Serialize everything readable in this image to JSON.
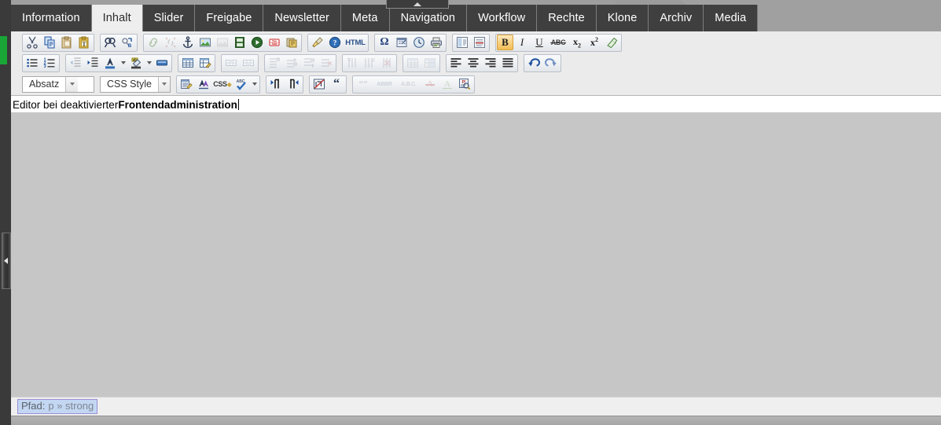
{
  "window": {
    "background_color": "#9b9b9b",
    "editor_chrome_color": "#ebebeb",
    "accent_green": "#1aa637"
  },
  "rail": {
    "collapse_handle_name": "collapse-panel-handle",
    "green_marker_color": "#1aa637"
  },
  "top_pulltab": {
    "name": "expand-toolbar-tab"
  },
  "tabs": [
    {
      "id": "information",
      "label": "Information",
      "active": false
    },
    {
      "id": "inhalt",
      "label": "Inhalt",
      "active": true
    },
    {
      "id": "slider",
      "label": "Slider",
      "active": false
    },
    {
      "id": "freigabe",
      "label": "Freigabe",
      "active": false
    },
    {
      "id": "newsletter",
      "label": "Newsletter",
      "active": false
    },
    {
      "id": "meta",
      "label": "Meta",
      "active": false
    },
    {
      "id": "navigation",
      "label": "Navigation",
      "active": false
    },
    {
      "id": "workflow",
      "label": "Workflow",
      "active": false
    },
    {
      "id": "rechte",
      "label": "Rechte",
      "active": false
    },
    {
      "id": "klone",
      "label": "Klone",
      "active": false
    },
    {
      "id": "archiv",
      "label": "Archiv",
      "active": false
    },
    {
      "id": "media",
      "label": "Media",
      "active": false
    }
  ],
  "toolbar": {
    "row1": [
      {
        "group": "clipboard",
        "buttons": [
          {
            "icon": "cut-icon",
            "title": "Ausschneiden",
            "state": "enabled"
          },
          {
            "icon": "copy-icon",
            "title": "Kopieren",
            "state": "enabled"
          },
          {
            "icon": "paste-icon",
            "title": "Einfügen",
            "state": "enabled"
          },
          {
            "icon": "paste-as-text-icon",
            "title": "Als Text einfügen",
            "state": "enabled"
          }
        ]
      },
      {
        "group": "search",
        "buttons": [
          {
            "icon": "find-icon",
            "title": "Suchen",
            "state": "enabled"
          },
          {
            "icon": "find-replace-icon",
            "title": "Suchen/Ersetzen",
            "state": "enabled"
          }
        ]
      },
      {
        "group": "insert",
        "buttons": [
          {
            "icon": "link-icon",
            "title": "Link einfügen",
            "state": "disabled"
          },
          {
            "icon": "unlink-icon",
            "title": "Link entfernen",
            "state": "disabled"
          },
          {
            "icon": "anchor-icon",
            "title": "Anker",
            "state": "enabled"
          },
          {
            "icon": "image-icon",
            "title": "Bild einfügen",
            "state": "enabled"
          },
          {
            "icon": "image-alt-icon",
            "title": "Bild",
            "state": "disabled"
          },
          {
            "icon": "filmstrip-icon",
            "title": "Medien",
            "state": "enabled"
          },
          {
            "icon": "play-media-icon",
            "title": "Media abspielen",
            "state": "enabled"
          },
          {
            "icon": "youtube-icon",
            "title": "YouTube",
            "state": "enabled"
          },
          {
            "icon": "flash-icon",
            "title": "Flash",
            "state": "enabled"
          }
        ]
      },
      {
        "group": "cleanup",
        "buttons": [
          {
            "icon": "broom-cleanup-icon",
            "title": "Aufräumen",
            "state": "enabled"
          },
          {
            "icon": "help-icon",
            "title": "Hilfe",
            "state": "enabled"
          },
          {
            "icon": "html-source-icon",
            "title": "HTML",
            "state": "enabled",
            "text": "HTML"
          }
        ]
      },
      {
        "group": "special",
        "buttons": [
          {
            "icon": "omega-special-char-icon",
            "title": "Sonderzeichen",
            "state": "enabled",
            "text": "Ω"
          },
          {
            "icon": "insert-date-icon",
            "title": "Datum",
            "state": "enabled"
          },
          {
            "icon": "insert-time-icon",
            "title": "Uhrzeit",
            "state": "enabled"
          },
          {
            "icon": "print-icon",
            "title": "Drucken",
            "state": "enabled"
          }
        ]
      },
      {
        "group": "breaks",
        "buttons": [
          {
            "icon": "page-break-icon",
            "title": "Seitenumbruch",
            "state": "enabled"
          },
          {
            "icon": "horizontal-rule-icon",
            "title": "Trennlinie",
            "state": "enabled"
          }
        ]
      },
      {
        "group": "formatting",
        "buttons": [
          {
            "icon": "bold-icon",
            "title": "Fett",
            "state": "active",
            "text": "B"
          },
          {
            "icon": "italic-icon",
            "title": "Kursiv",
            "state": "enabled",
            "text": "I"
          },
          {
            "icon": "underline-icon",
            "title": "Unterstrichen",
            "state": "enabled",
            "text": "U"
          },
          {
            "icon": "strikethrough-icon",
            "title": "Durchgestrichen",
            "state": "enabled",
            "text": "ABC"
          },
          {
            "icon": "subscript-icon",
            "title": "Tiefgestellt",
            "state": "enabled",
            "text": "x₂"
          },
          {
            "icon": "superscript-icon",
            "title": "Hochgestellt",
            "state": "enabled",
            "text": "x²"
          },
          {
            "icon": "remove-format-icon",
            "title": "Format entfernen",
            "state": "enabled"
          }
        ]
      }
    ],
    "row2": [
      {
        "group": "lists",
        "buttons": [
          {
            "icon": "bullet-list-icon",
            "title": "Aufzählung",
            "state": "enabled"
          },
          {
            "icon": "numbered-list-icon",
            "title": "Nummerierte Liste",
            "state": "enabled"
          }
        ]
      },
      {
        "group": "indent-color",
        "buttons": [
          {
            "icon": "outdent-icon",
            "title": "Ausrücken",
            "state": "disabled"
          },
          {
            "icon": "indent-icon",
            "title": "Einrücken",
            "state": "enabled"
          },
          {
            "icon": "text-color-icon",
            "title": "Textfarbe",
            "state": "enabled",
            "has_caret": true
          },
          {
            "icon": "highlight-color-icon",
            "title": "Hintergrundfarbe",
            "state": "enabled",
            "has_caret": true
          },
          {
            "icon": "color-swatch-icon",
            "title": "Farbe",
            "state": "enabled"
          }
        ]
      },
      {
        "group": "table-main",
        "buttons": [
          {
            "icon": "insert-table-icon",
            "title": "Tabelle einfügen",
            "state": "enabled"
          },
          {
            "icon": "table-properties-icon",
            "title": "Tabelleneigenschaften",
            "state": "enabled"
          }
        ]
      },
      {
        "group": "table-cells",
        "buttons": [
          {
            "icon": "merge-cells-icon",
            "title": "Zellen verbinden",
            "state": "disabled"
          },
          {
            "icon": "split-cells-icon",
            "title": "Zellen teilen",
            "state": "disabled"
          }
        ]
      },
      {
        "group": "table-rows",
        "buttons": [
          {
            "icon": "row-properties-icon",
            "title": "Zeileneigenschaften",
            "state": "disabled"
          },
          {
            "icon": "insert-row-before-icon",
            "title": "Zeile davor",
            "state": "disabled"
          },
          {
            "icon": "insert-row-after-icon",
            "title": "Zeile danach",
            "state": "disabled"
          },
          {
            "icon": "delete-row-icon",
            "title": "Zeile löschen",
            "state": "disabled"
          }
        ]
      },
      {
        "group": "table-cols",
        "buttons": [
          {
            "icon": "insert-col-before-icon",
            "title": "Spalte davor",
            "state": "disabled"
          },
          {
            "icon": "insert-col-after-icon",
            "title": "Spalte danach",
            "state": "disabled"
          },
          {
            "icon": "delete-col-icon",
            "title": "Spalte löschen",
            "state": "disabled"
          }
        ]
      },
      {
        "group": "table-extra",
        "buttons": [
          {
            "icon": "table-grid-icon",
            "title": "Tabellenraster",
            "state": "disabled"
          },
          {
            "icon": "table-overlay-icon",
            "title": "Tabellenoverlay",
            "state": "disabled"
          }
        ]
      },
      {
        "group": "align",
        "buttons": [
          {
            "icon": "align-left-icon",
            "title": "Linksbündig",
            "state": "enabled"
          },
          {
            "icon": "align-center-icon",
            "title": "Zentriert",
            "state": "enabled"
          },
          {
            "icon": "align-right-icon",
            "title": "Rechtsbündig",
            "state": "enabled"
          },
          {
            "icon": "align-justify-icon",
            "title": "Blocksatz",
            "state": "enabled"
          }
        ]
      },
      {
        "group": "history",
        "buttons": [
          {
            "icon": "undo-icon",
            "title": "Rückgängig",
            "state": "enabled"
          },
          {
            "icon": "redo-icon",
            "title": "Wiederholen",
            "state": "enabled"
          }
        ]
      }
    ],
    "row3": {
      "format_select": {
        "value": "Absatz",
        "name": "format-select"
      },
      "cssstyle_select": {
        "value": "CSS Style",
        "name": "css-style-select"
      },
      "buttons_a": [
        {
          "icon": "edit-attributes-icon",
          "title": "Attribute bearbeiten",
          "state": "enabled"
        },
        {
          "icon": "advanced-font-icon",
          "title": "Schrift",
          "state": "enabled"
        },
        {
          "icon": "css-edit-icon",
          "title": "CSS",
          "state": "enabled",
          "text": "CSS"
        },
        {
          "icon": "spellcheck-icon",
          "title": "Rechtschreibprüfung",
          "state": "enabled",
          "has_caret": true
        }
      ],
      "buttons_b": [
        {
          "icon": "ltr-direction-icon",
          "title": "Textrichtung links-rechts",
          "state": "enabled"
        },
        {
          "icon": "rtl-direction-icon",
          "title": "Textrichtung rechts-links",
          "state": "enabled"
        }
      ],
      "buttons_c": [
        {
          "icon": "nonbreaking-icon",
          "title": "Geschütztes Leerzeichen",
          "state": "enabled"
        },
        {
          "icon": "blockquote-icon",
          "title": "Zitat",
          "state": "enabled",
          "text": "“"
        }
      ],
      "buttons_d": [
        {
          "icon": "citation-icon",
          "title": "Zitat",
          "state": "disabled",
          "text": "“ ”"
        },
        {
          "icon": "abbreviation-icon",
          "title": "Abkürzung",
          "state": "disabled",
          "text": "ABBR"
        },
        {
          "icon": "acronym-icon",
          "title": "Akronym",
          "state": "disabled",
          "text": "A.B.C."
        },
        {
          "icon": "delete-mark-icon",
          "title": "Gelöscht",
          "state": "disabled",
          "text": "A"
        },
        {
          "icon": "insert-mark-icon",
          "title": "Eingefügt",
          "state": "disabled",
          "text": "A"
        },
        {
          "icon": "preview-icon",
          "title": "Vorschau",
          "state": "enabled"
        }
      ]
    }
  },
  "content": {
    "text_normal": "Editor bei deaktivierter ",
    "text_bold": "Frontendadministration",
    "caret_visible": true
  },
  "statusbar": {
    "path_label": "Pfad:",
    "path_value": "p » strong",
    "chip_bg": "#c3d7f3",
    "chip_border": "#9a8ed4"
  }
}
